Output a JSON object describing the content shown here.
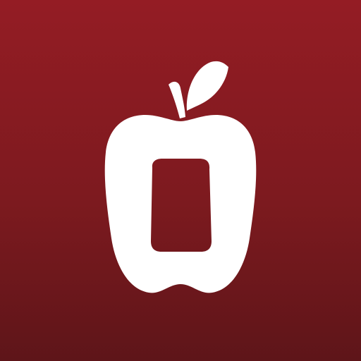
{
  "app_icon": {
    "logo_icon": "apple-icon",
    "colors": {
      "background_top": "#941c24",
      "background_bottom": "#5e1519",
      "logo": "#ffffff"
    }
  }
}
